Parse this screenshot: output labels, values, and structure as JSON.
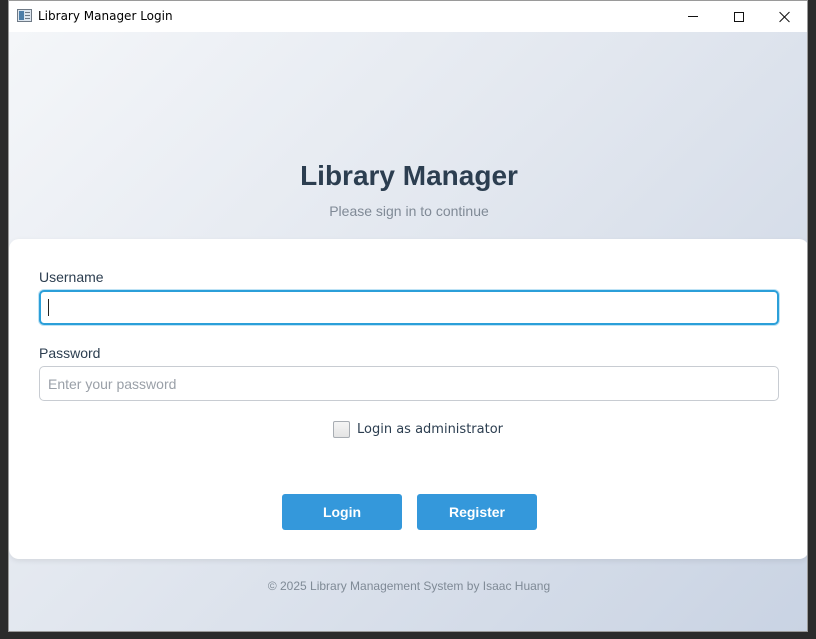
{
  "window": {
    "title": "Library Manager Login",
    "icon": "app-window-icon",
    "controls": [
      "minimize-icon",
      "maximize-icon",
      "close-icon"
    ]
  },
  "header": {
    "title": "Library Manager",
    "subtitle": "Please sign in to continue"
  },
  "form": {
    "username_label": "Username",
    "username_value": "",
    "password_label": "Password",
    "password_placeholder": "Enter your password",
    "admin_checkbox_label": "Login as administrator",
    "admin_checked": false,
    "login_label": "Login",
    "register_label": "Register"
  },
  "footer": {
    "text": "© 2025 Library Management System by Isaac Huang"
  },
  "colors": {
    "accent": "#3498db",
    "focus_border": "#2b9fd9",
    "heading": "#2c3e50"
  }
}
